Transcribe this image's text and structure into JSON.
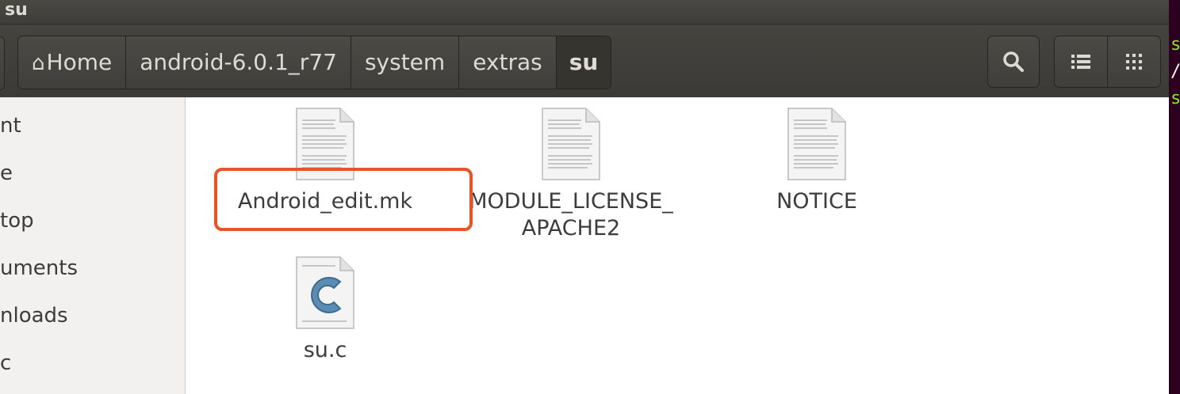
{
  "window": {
    "title": "su"
  },
  "pathbar": {
    "home_glyph": "⌂",
    "home_label": "Home",
    "crumbs": [
      "android-6.0.1_r77",
      "system",
      "extras",
      "su"
    ]
  },
  "toolbar": {
    "search_icon": "search-icon",
    "list_view_icon": "list-view-icon",
    "grid_view_icon": "grid-view-icon"
  },
  "sidebar": {
    "items": [
      "nt",
      "e",
      "top",
      "uments",
      "nloads",
      "c"
    ]
  },
  "files": [
    {
      "name": "Android_edit.mk",
      "icon": "text-file-icon"
    },
    {
      "name_line1": "MODULE_LICENSE_",
      "name_line2": "APACHE2",
      "icon": "text-file-icon"
    },
    {
      "name": "NOTICE",
      "icon": "text-file-icon"
    },
    {
      "name": "su.c",
      "icon": "c-source-file-icon"
    }
  ],
  "terminal": {
    "line1": "s",
    "line2": "/",
    "line3": "s"
  },
  "colors": {
    "highlight": "#e8532a",
    "terminal_bg": "#2c001e",
    "prompt_green": "#8ae234"
  }
}
